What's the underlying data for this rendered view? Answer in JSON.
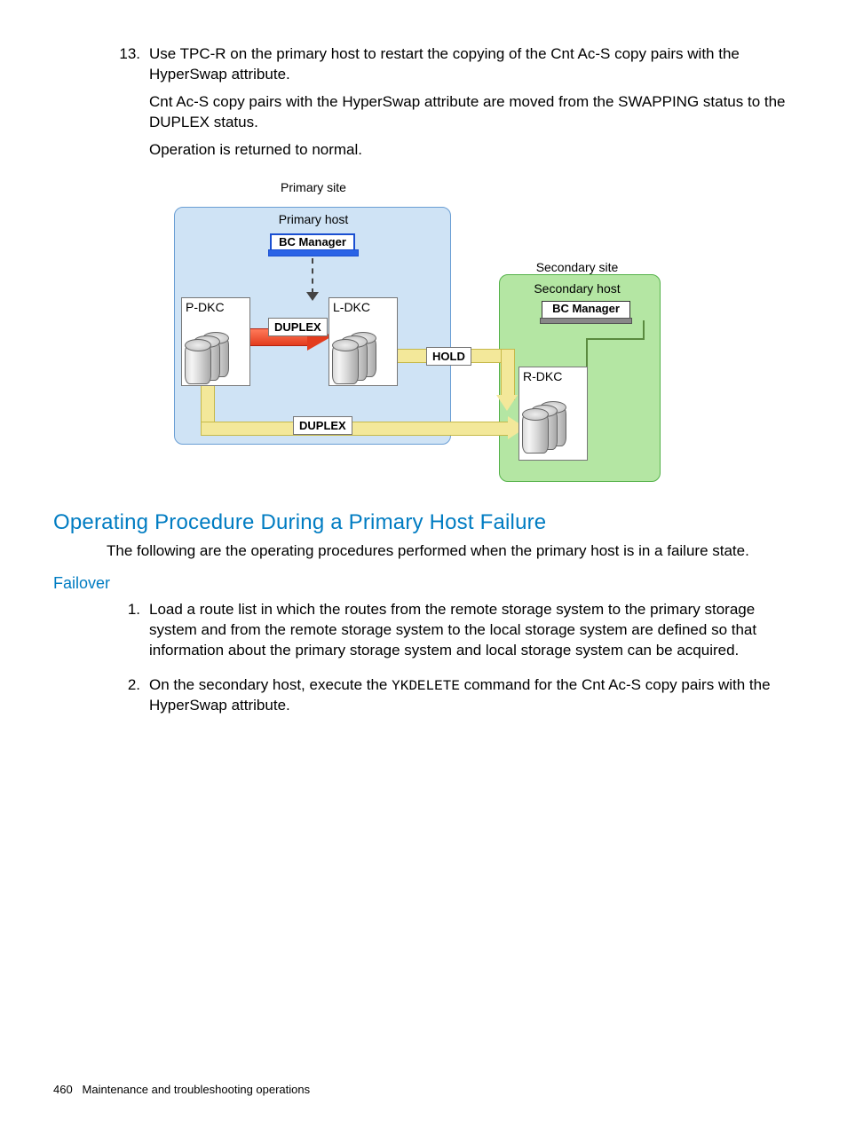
{
  "step13": {
    "marker": "13.",
    "p1": "Use TPC-R on the primary host to restart the copying of the Cnt Ac-S copy pairs with the HyperSwap attribute.",
    "p2": "Cnt Ac-S copy pairs with the HyperSwap attribute are moved from the SWAPPING status to the DUPLEX status.",
    "p3": "Operation is returned to normal."
  },
  "diagram": {
    "primary_site": "Primary site",
    "primary_host": "Primary host",
    "bc_manager": "BC Manager",
    "secondary_site": "Secondary site",
    "secondary_host": "Secondary host",
    "pdkc": "P-DKC",
    "ldkc": "L-DKC",
    "rdkc": "R-DKC",
    "duplex": "DUPLEX",
    "hold": "HOLD"
  },
  "h2": "Operating Procedure During a Primary Host Failure",
  "intro": "The following are the operating procedures performed when the primary host is in a failure state.",
  "h3": "Failover",
  "failover": {
    "m1": "1.",
    "p1": "Load a route list in which the routes from the remote storage system to the primary storage system and from the remote storage system to the local storage system are defined so that information about the primary storage system and local storage system can be acquired.",
    "m2": "2.",
    "p2a": "On the secondary host, execute the ",
    "p2cmd": "YKDELETE",
    "p2b": " command for the Cnt Ac-S copy pairs with the HyperSwap attribute."
  },
  "footer": {
    "page": "460",
    "chapter": "Maintenance and troubleshooting operations"
  }
}
